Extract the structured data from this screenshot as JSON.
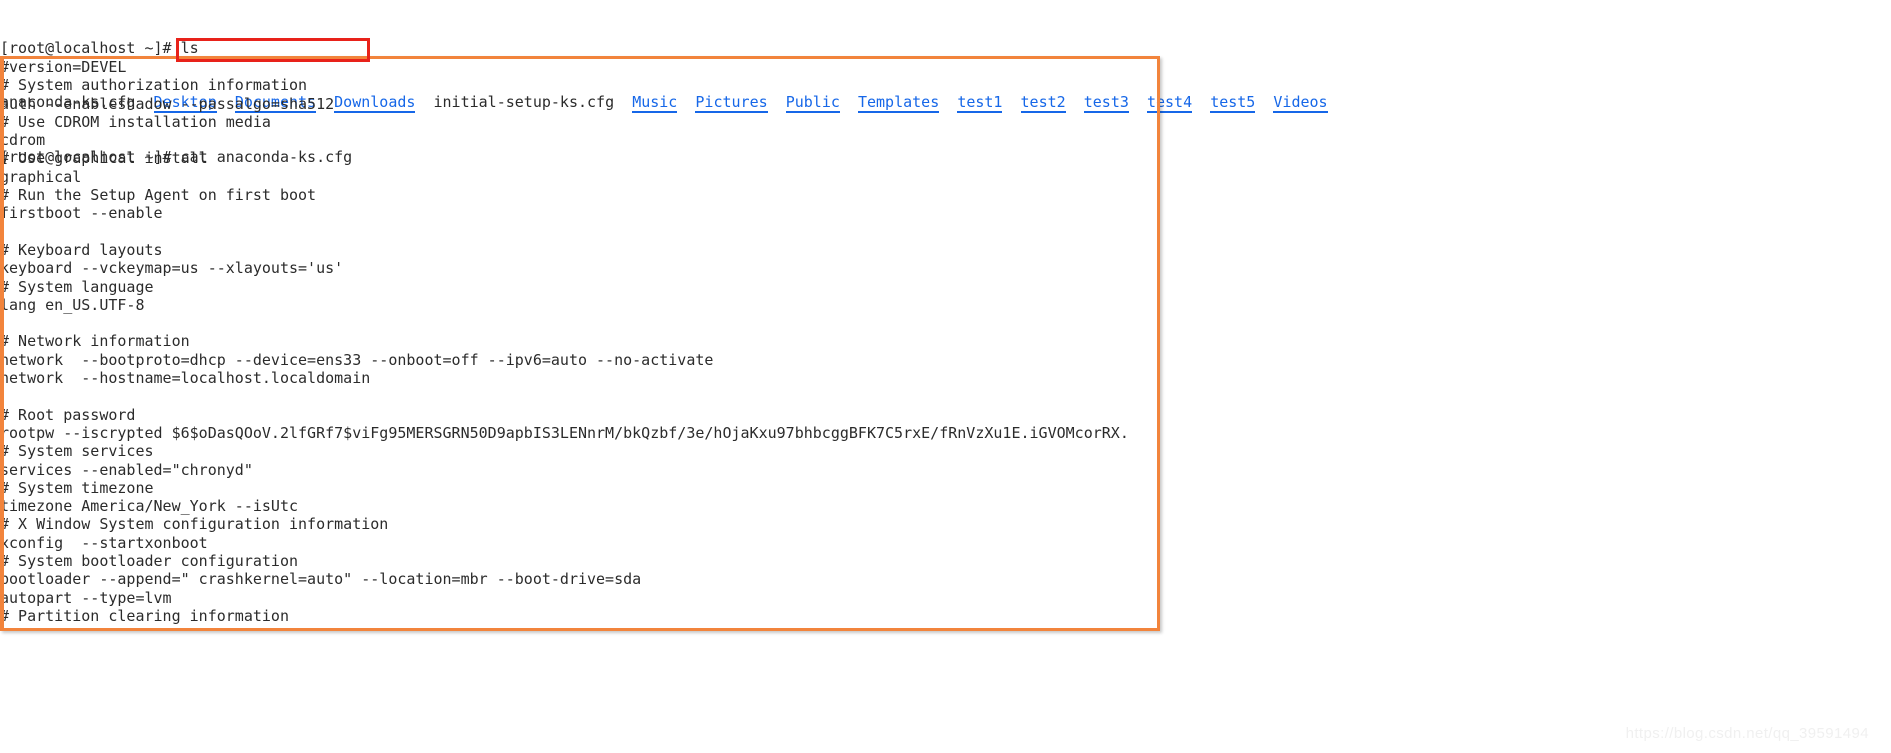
{
  "terminal": {
    "prompt_lines": [
      {
        "segments": [
          {
            "text": "[root@localhost ~]# ls",
            "kind": "plain"
          }
        ]
      },
      {
        "segments": [
          {
            "text": "anaconda-ks.cfg  ",
            "kind": "plain"
          },
          {
            "text": "Desktop",
            "kind": "dir"
          },
          {
            "text": "  ",
            "kind": "plain"
          },
          {
            "text": "Documents",
            "kind": "dir"
          },
          {
            "text": "  ",
            "kind": "plain"
          },
          {
            "text": "Downloads",
            "kind": "dir"
          },
          {
            "text": "  initial-setup-ks.cfg  ",
            "kind": "plain"
          },
          {
            "text": "Music",
            "kind": "dir"
          },
          {
            "text": "  ",
            "kind": "plain"
          },
          {
            "text": "Pictures",
            "kind": "dir"
          },
          {
            "text": "  ",
            "kind": "plain"
          },
          {
            "text": "Public",
            "kind": "dir"
          },
          {
            "text": "  ",
            "kind": "plain"
          },
          {
            "text": "Templates",
            "kind": "dir"
          },
          {
            "text": "  ",
            "kind": "plain"
          },
          {
            "text": "test1",
            "kind": "dir"
          },
          {
            "text": "  ",
            "kind": "plain"
          },
          {
            "text": "test2",
            "kind": "dir"
          },
          {
            "text": "  ",
            "kind": "plain"
          },
          {
            "text": "test3",
            "kind": "dir"
          },
          {
            "text": "  ",
            "kind": "plain"
          },
          {
            "text": "test4",
            "kind": "dir"
          },
          {
            "text": "  ",
            "kind": "plain"
          },
          {
            "text": "test5",
            "kind": "dir"
          },
          {
            "text": "  ",
            "kind": "plain"
          },
          {
            "text": "Videos",
            "kind": "dir"
          }
        ]
      },
      {
        "segments": [
          {
            "text": "[root@localhost ~]# cat anaconda-ks.cfg",
            "kind": "plain"
          }
        ]
      }
    ],
    "prompt_text": "[root@localhost ~]#",
    "command_ls": "ls",
    "command_cat": "cat anaconda-ks.cfg",
    "file_lines": [
      "#version=DEVEL",
      "# System authorization information",
      "auth --enableshadow --passalgo=sha512",
      "# Use CDROM installation media",
      "cdrom",
      "# Use graphical install",
      "graphical",
      "# Run the Setup Agent on first boot",
      "firstboot --enable",
      "",
      "# Keyboard layouts",
      "keyboard --vckeymap=us --xlayouts='us'",
      "# System language",
      "lang en_US.UTF-8",
      "",
      "# Network information",
      "network  --bootproto=dhcp --device=ens33 --onboot=off --ipv6=auto --no-activate",
      "network  --hostname=localhost.localdomain",
      "",
      "# Root password",
      "rootpw --iscrypted $6$oDasQOoV.2lfGRf7$viFg95MERSGRN50D9apbIS3LENnrM/bkQzbf/3e/hOjaKxu97bhbcggBFK7C5rxE/fRnVzXu1E.iGVOMcorRX.",
      "# System services",
      "services --enabled=\"chronyd\"",
      "# System timezone",
      "timezone America/New_York --isUtc",
      "# X Window System configuration information",
      "xconfig  --startxonboot",
      "# System bootloader configuration",
      "bootloader --append=\" crashkernel=auto\" --location=mbr --boot-drive=sda",
      "autopart --type=lvm",
      "# Partition clearing information"
    ]
  },
  "annotations": {
    "command_box_color": "#e8221a",
    "content_box_color": "#f2843c",
    "directory_color": "#1667e8",
    "text_color": "#2b2b2b"
  },
  "watermark": {
    "text": "https://blog.csdn.net/qq_39591494"
  }
}
